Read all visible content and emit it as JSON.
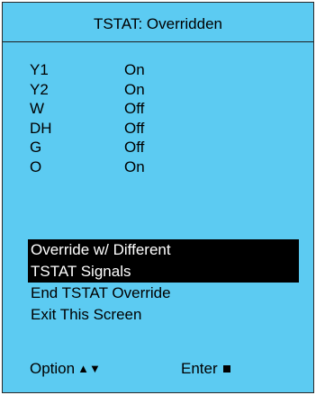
{
  "header": {
    "title": "TSTAT: Overridden"
  },
  "signals": [
    {
      "name": "Y1",
      "value": "On"
    },
    {
      "name": "Y2",
      "value": "On"
    },
    {
      "name": "W",
      "value": "Off"
    },
    {
      "name": "DH",
      "value": "Off"
    },
    {
      "name": "G",
      "value": "Off"
    },
    {
      "name": "O",
      "value": "On"
    }
  ],
  "menu": {
    "items": [
      {
        "label": "Override w/ Different",
        "selected": true
      },
      {
        "label": "TSTAT Signals",
        "selected": true
      },
      {
        "label": "End TSTAT Override",
        "selected": false
      },
      {
        "label": "Exit This Screen",
        "selected": false
      }
    ]
  },
  "footer": {
    "option_label": "Option",
    "option_icon": "up-down-arrows-icon",
    "enter_label": "Enter",
    "enter_icon": "square-icon"
  },
  "colors": {
    "screen_background": "#5ccbf2",
    "highlight_background": "#000000",
    "highlight_text": "#ffffff"
  }
}
